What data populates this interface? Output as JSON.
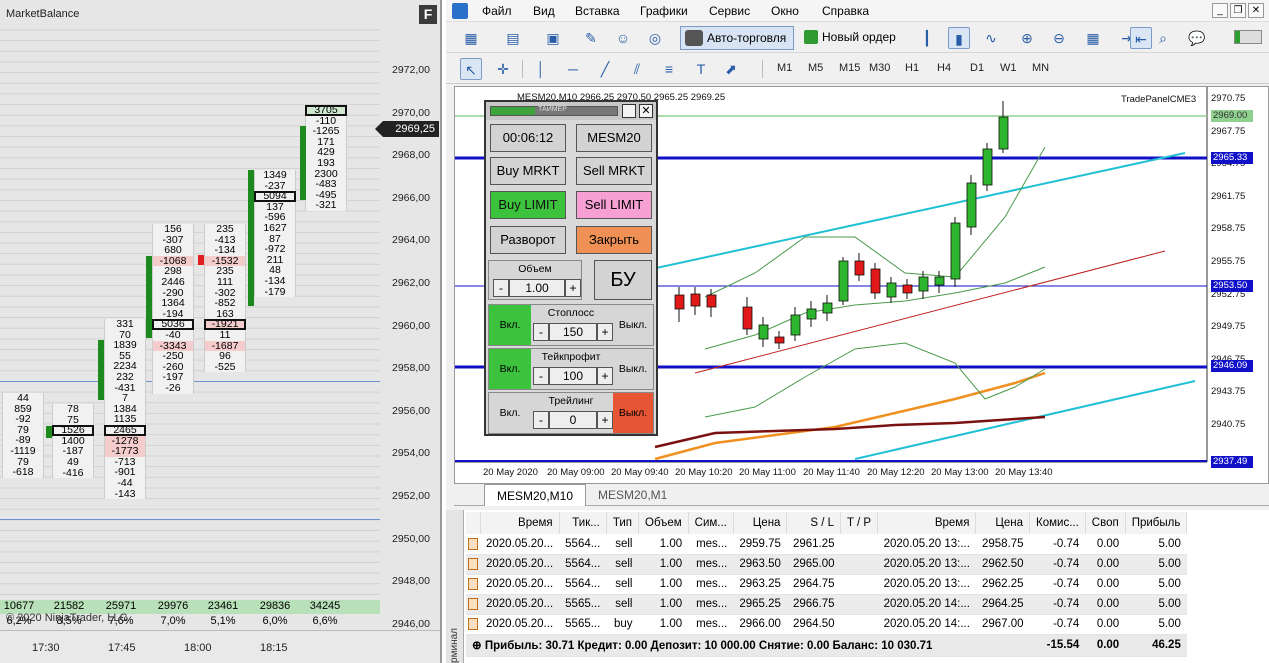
{
  "mb": {
    "title": "MarketBalance",
    "close": "F",
    "price_badge": "2969,25",
    "price_ticks": [
      "2972,00",
      "2970,00",
      "2968,00",
      "2966,00",
      "2964,00",
      "2962,00",
      "2960,00",
      "2958,00",
      "2956,00",
      "2954,00",
      "2952,00",
      "2950,00",
      "2948,00",
      "2946,00"
    ],
    "columns": [
      {
        "cells": [
          "44",
          "859",
          "-92",
          "79",
          "-89",
          "-1119",
          "79",
          "-618"
        ]
      },
      {
        "cells": [
          "78",
          "75",
          "1526",
          "1400",
          "-187",
          "49",
          "-416"
        ]
      },
      {
        "cells": [
          "331",
          "70",
          "1839",
          "55",
          "2234",
          "232",
          "-431",
          "7",
          "1384",
          "1135",
          "2465",
          "-1278",
          "-1773",
          "-713",
          "-901",
          "-44",
          "-143"
        ]
      },
      {
        "cells": [
          "156",
          "-307",
          "680",
          "-1068",
          "298",
          "2446",
          "-290",
          "1364",
          "-194",
          "5036",
          "-40",
          "-3343",
          "-250",
          "-260",
          "-197",
          "-26"
        ]
      },
      {
        "cells": [
          "235",
          "-413",
          "-134",
          "-1532",
          "235",
          "111",
          "-302",
          "-852",
          "163",
          "-1921",
          "11",
          "-1687",
          "96",
          "-525"
        ]
      },
      {
        "cells": [
          "1349",
          "-237",
          "5094",
          "137",
          "-596",
          "1627",
          "87",
          "-972",
          "211",
          "48",
          "-134",
          "-179"
        ]
      },
      {
        "cells": [
          "3705",
          "-110",
          "-1265",
          "171",
          "429",
          "193",
          "2300",
          "-483",
          "-495",
          "-321"
        ]
      }
    ],
    "volumes": [
      "10677",
      "21582",
      "25971",
      "29976",
      "23461",
      "29836",
      "34245"
    ],
    "percents": [
      "6,2%",
      "8,5%",
      "7,6%",
      "7,0%",
      "5,1%",
      "6,0%",
      "6,6%"
    ],
    "copyright": "© 2020 NinjaTrader, LLC",
    "times": [
      "17:30",
      "17:45",
      "18:00",
      "18:15"
    ]
  },
  "menu": [
    "Файл",
    "Вид",
    "Вставка",
    "Графики",
    "Сервис",
    "Окно",
    "Справка"
  ],
  "toolbar": {
    "auto_trading": "Авто-торговля",
    "new_order": "Новый ордер"
  },
  "timeframes": [
    "M1",
    "M5",
    "M15",
    "M30",
    "H1",
    "H4",
    "D1",
    "W1",
    "MN"
  ],
  "chart": {
    "title": "MESM20,M10  2966.25 2970.50 2965.25 2969.25",
    "panel_name": "TradePanelCME3",
    "price_axis": [
      "2970.75",
      "2967.75",
      "2964.75",
      "2961.75",
      "2958.75",
      "2955.75",
      "2952.75",
      "2949.75",
      "2946.75",
      "2943.75",
      "2940.75"
    ],
    "price_boxes": [
      {
        "label": "2969.00",
        "color": "#8fd08f"
      },
      {
        "label": "2965.33",
        "color": "#1010c8"
      },
      {
        "label": "2953.50",
        "color": "#1010c8"
      },
      {
        "label": "2946.09",
        "color": "#1010c8"
      },
      {
        "label": "2937.49",
        "color": "#1010c8"
      }
    ],
    "time_axis": [
      "20 May 2020",
      "20 May 09:00",
      "20 May 09:40",
      "20 May 10:20",
      "20 May 11:00",
      "20 May 11:40",
      "20 May 12:20",
      "20 May 13:00",
      "20 May 13:40"
    ]
  },
  "trade_panel": {
    "timer_label": "ТАЙМЕР",
    "timer": "00:06:12",
    "symbol": "MESM20",
    "buy_mrkt": "Buy MRKT",
    "sell_mrkt": "Sell MRKT",
    "buy_limit": "Buy LIMIT",
    "sell_limit": "Sell LIMIT",
    "reverse": "Разворот",
    "close": "Закрыть",
    "volume_label": "Объем",
    "volume": "1.00",
    "be": "БУ",
    "minus": "-",
    "plus": "+",
    "stoploss_label": "Стоплосс",
    "stoploss": "150",
    "takeprofit_label": "Тейкпрофит",
    "takeprofit": "100",
    "trailing_label": "Трейлинг",
    "trailing": "0",
    "on": "Вкл.",
    "off": "Выкл."
  },
  "tabs": [
    "MESM20,M10",
    "MESM20,M1"
  ],
  "terminal": {
    "side_label": "Терминал",
    "headers": [
      "Время",
      "Тик...",
      "Тип",
      "Объем",
      "Сим...",
      "Цена",
      "S / L",
      "T / P",
      "Время",
      "Цена",
      "Комис...",
      "Своп",
      "Прибыль"
    ],
    "rows": [
      [
        "2020.05.20...",
        "5564...",
        "sell",
        "1.00",
        "mes...",
        "2959.75",
        "2961.25",
        "",
        "2020.05.20 13:...",
        "2958.75",
        "-0.74",
        "0.00",
        "5.00"
      ],
      [
        "2020.05.20...",
        "5564...",
        "sell",
        "1.00",
        "mes...",
        "2963.50",
        "2965.00",
        "",
        "2020.05.20 13:...",
        "2962.50",
        "-0.74",
        "0.00",
        "5.00"
      ],
      [
        "2020.05.20...",
        "5564...",
        "sell",
        "1.00",
        "mes...",
        "2963.25",
        "2964.75",
        "",
        "2020.05.20 13:...",
        "2962.25",
        "-0.74",
        "0.00",
        "5.00"
      ],
      [
        "2020.05.20...",
        "5565...",
        "sell",
        "1.00",
        "mes...",
        "2965.25",
        "2966.75",
        "",
        "2020.05.20 14:...",
        "2964.25",
        "-0.74",
        "0.00",
        "5.00"
      ],
      [
        "2020.05.20...",
        "5565...",
        "buy",
        "1.00",
        "mes...",
        "2966.00",
        "2964.50",
        "",
        "2020.05.20 14:...",
        "2967.00",
        "-0.74",
        "0.00",
        "5.00"
      ]
    ],
    "summary": "Прибыль: 30.71  Кредит: 0.00  Депозит: 10 000.00  Снятие: 0.00  Баланс: 10 030.71",
    "summary_commission": "-15.54",
    "summary_swap": "0.00",
    "summary_profit": "46.25"
  }
}
